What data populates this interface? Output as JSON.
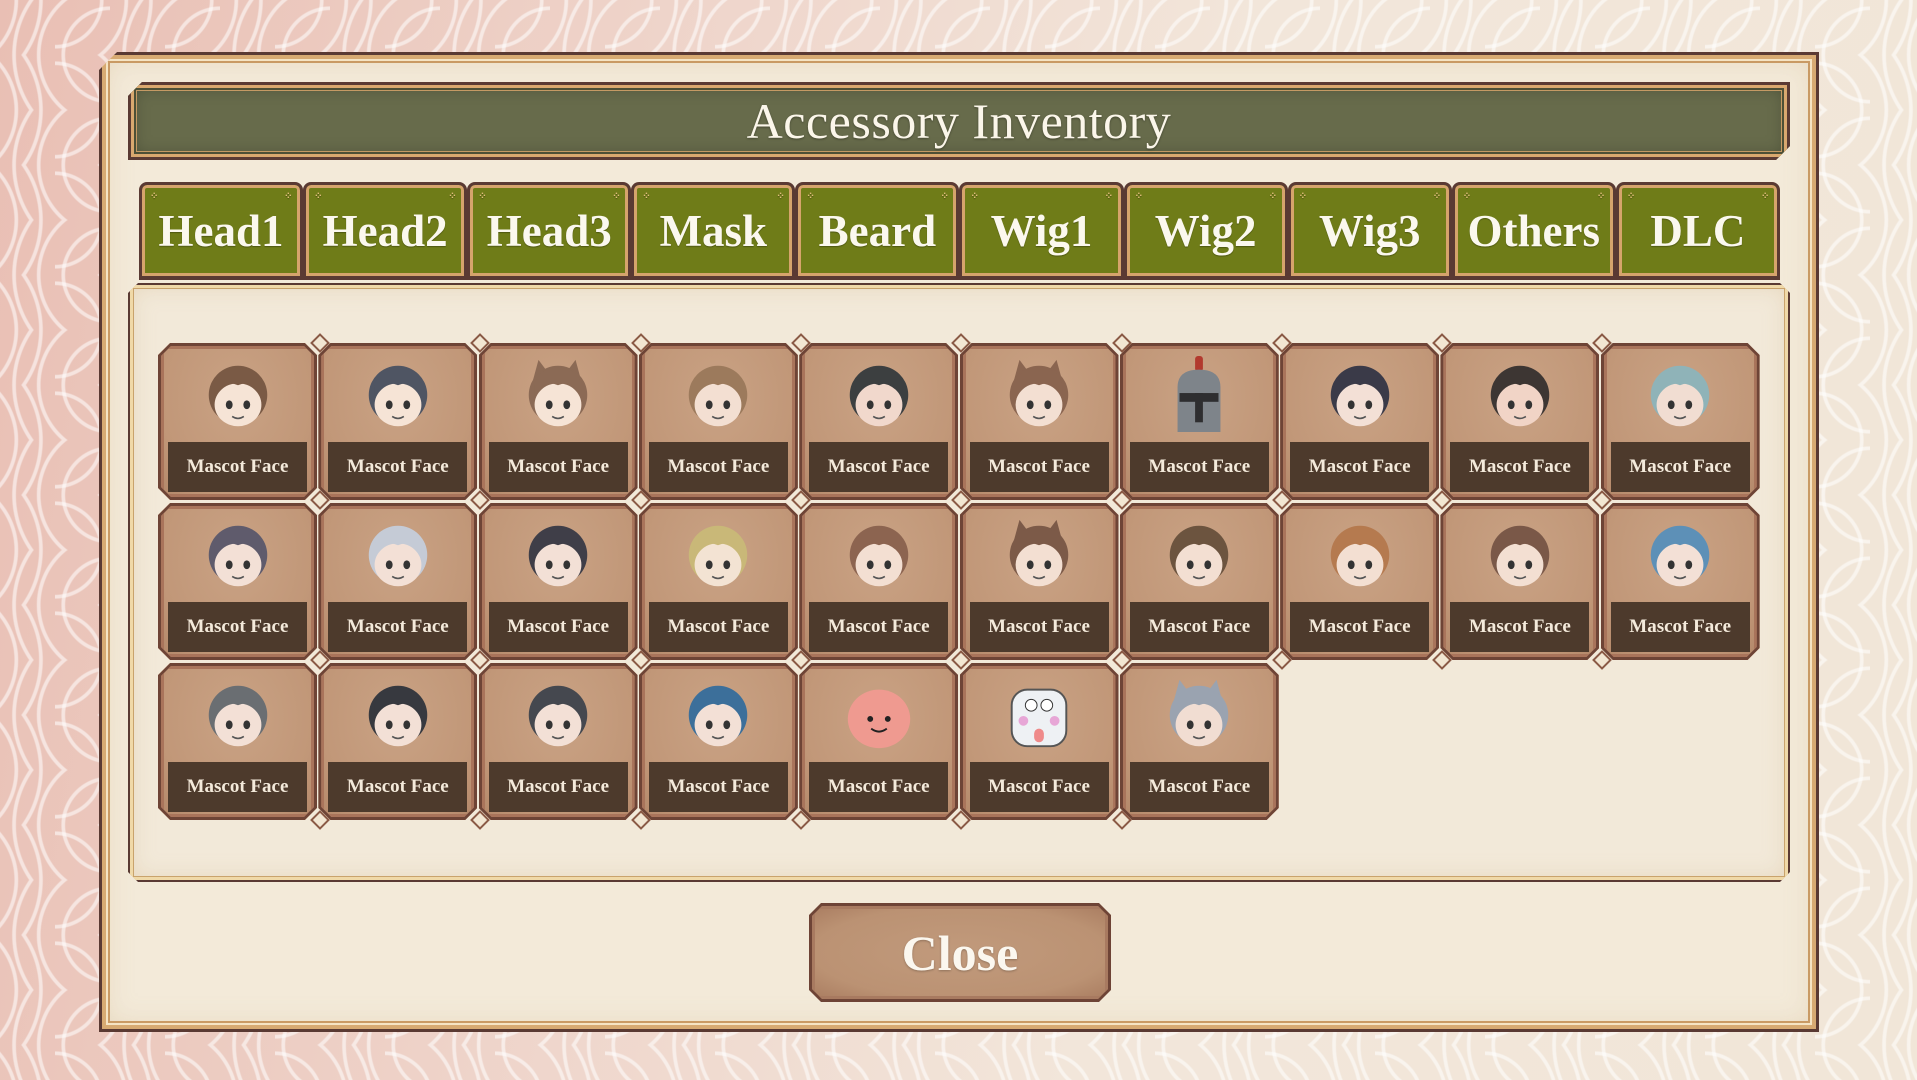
{
  "window": {
    "title": "Accessory Inventory"
  },
  "tabs": [
    {
      "label": "Head1",
      "id": "head1"
    },
    {
      "label": "Head2",
      "id": "head2"
    },
    {
      "label": "Head3",
      "id": "head3"
    },
    {
      "label": "Mask",
      "id": "mask"
    },
    {
      "label": "Beard",
      "id": "beard"
    },
    {
      "label": "Wig1",
      "id": "wig1"
    },
    {
      "label": "Wig2",
      "id": "wig2"
    },
    {
      "label": "Wig3",
      "id": "wig3"
    },
    {
      "label": "Others",
      "id": "others"
    },
    {
      "label": "DLC",
      "id": "dlc"
    }
  ],
  "items": [
    {
      "label": "Mascot Face",
      "hair": "#7a5a45",
      "skin": "#f6e4d6",
      "style": "round-brown"
    },
    {
      "label": "Mascot Face",
      "hair": "#4f5563",
      "skin": "#f6e4d6",
      "style": "spiky-dark"
    },
    {
      "label": "Mascot Face",
      "hair": "#8b6a55",
      "skin": "#f6e4d6",
      "style": "cat-ears-brown"
    },
    {
      "label": "Mascot Face",
      "hair": "#9c7a5c",
      "skin": "#f3dfd2",
      "style": "bob-light-brown"
    },
    {
      "label": "Mascot Face",
      "hair": "#3c3f40",
      "skin": "#f1d8cc",
      "style": "spiky-yellow-streak"
    },
    {
      "label": "Mascot Face",
      "hair": "#8a6550",
      "skin": "#f3dfd2",
      "style": "cat-ears-twintails"
    },
    {
      "label": "Mascot Face",
      "hair": "#6d7278",
      "skin": "#6d7278",
      "style": "knight-helmet"
    },
    {
      "label": "Mascot Face",
      "hair": "#3a3a48",
      "skin": "#f3e0d6",
      "style": "long-dark"
    },
    {
      "label": "Mascot Face",
      "hair": "#3d3633",
      "skin": "#f1d4c6",
      "style": "mustache-man"
    },
    {
      "label": "Mascot Face",
      "hair": "#8fb3b8",
      "skin": "#f1ddd2",
      "style": "silver-monocle"
    },
    {
      "label": "Mascot Face",
      "hair": "#5f5b6c",
      "skin": "#f3e0d6",
      "style": "grey-bob"
    },
    {
      "label": "Mascot Face",
      "hair": "#c5cbd6",
      "skin": "#f3e0d6",
      "style": "silver-braid"
    },
    {
      "label": "Mascot Face",
      "hair": "#3f3e48",
      "skin": "#f3e0d6",
      "style": "dark-ahoge"
    },
    {
      "label": "Mascot Face",
      "hair": "#c9b878",
      "skin": "#f3e3d3",
      "style": "blonde-long"
    },
    {
      "label": "Mascot Face",
      "hair": "#8c6450",
      "skin": "#f3dfd2",
      "style": "brown-messy"
    },
    {
      "label": "Mascot Face",
      "hair": "#7c5a48",
      "skin": "#f3dfd2",
      "style": "cat-on-head"
    },
    {
      "label": "Mascot Face",
      "hair": "#6c543f",
      "skin": "#f3dfd2",
      "style": "brown-short"
    },
    {
      "label": "Mascot Face",
      "hair": "#b57a4f",
      "skin": "#f3dfd2",
      "style": "orange-ponytail"
    },
    {
      "label": "Mascot Face",
      "hair": "#7a5848",
      "skin": "#f3dfd2",
      "style": "brown-eyepatch"
    },
    {
      "label": "Mascot Face",
      "hair": "#5d90b7",
      "skin": "#f3e0d6",
      "style": "blue-spiky"
    },
    {
      "label": "Mascot Face",
      "hair": "#6a6e72",
      "skin": "#f3e0d6",
      "style": "grey-antenna"
    },
    {
      "label": "Mascot Face",
      "hair": "#37393f",
      "skin": "#f3e0d6",
      "style": "black-messy"
    },
    {
      "label": "Mascot Face",
      "hair": "#45484f",
      "skin": "#f3e0d6",
      "style": "dark-spiky-bandage"
    },
    {
      "label": "Mascot Face",
      "hair": "#3c6f9a",
      "skin": "#f3e0d6",
      "style": "blue-long-small"
    },
    {
      "label": "Mascot Face",
      "hair": "#ee8f86",
      "skin": "#f7c6bd",
      "style": "pink-blob"
    },
    {
      "label": "Mascot Face",
      "hair": "#e8ecef",
      "skin": "#e8ecef",
      "style": "white-mascot-tongue"
    },
    {
      "label": "Mascot Face",
      "hair": "#9aa3b0",
      "skin": "#f1ddd2",
      "style": "silver-cat-eyepatch"
    }
  ],
  "footer": {
    "close_label": "Close"
  },
  "colors": {
    "tab_green": "#6f7c18",
    "title_olive": "#676b4b",
    "card_tan": "#c39a7b",
    "label_dark": "#4d3a2c",
    "frame_brown": "#5a3a33"
  }
}
